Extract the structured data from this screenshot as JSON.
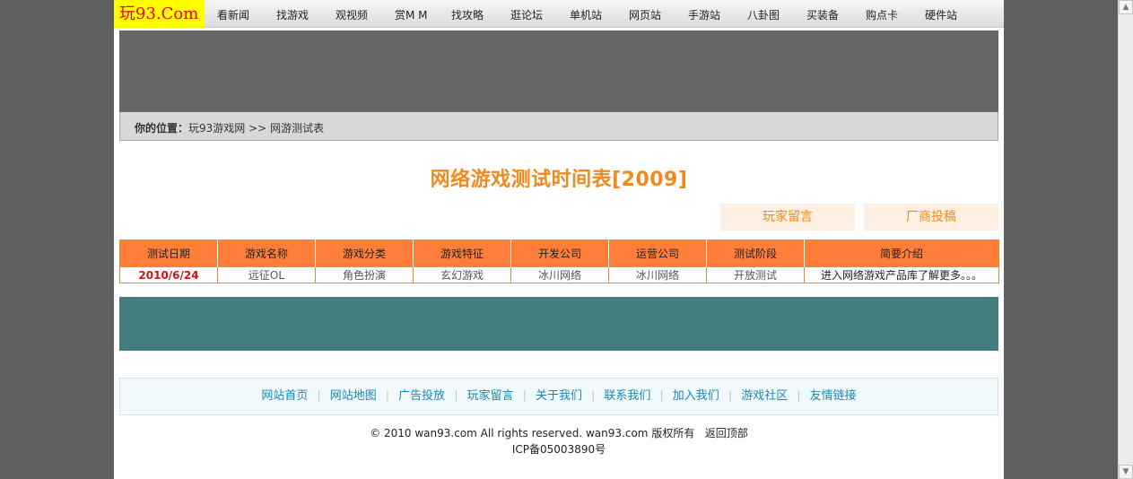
{
  "logo": "玩93.Com",
  "nav": [
    "看新闻",
    "找游戏",
    "观视频",
    "赏M M",
    "找攻略",
    "逛论坛",
    "单机站",
    "网页站",
    "手游站",
    "八卦图",
    "买装备",
    "购点卡",
    "硬件站"
  ],
  "breadcrumb": {
    "label": "你的位置：",
    "home": "玩93游戏网",
    "sep": ">>",
    "current": "网游测试表"
  },
  "page_title": "网络游戏测试时间表[2009]",
  "actions": {
    "player_message": "玩家留言",
    "vendor_submit": "厂商投稿"
  },
  "table": {
    "headers": [
      "测试日期",
      "游戏名称",
      "游戏分类",
      "游戏特征",
      "开发公司",
      "运营公司",
      "测试阶段",
      "简要介绍"
    ],
    "rows": [
      [
        "2010/6/24",
        "远征OL",
        "角色扮演",
        "玄幻游戏",
        "冰川网络",
        "冰川网络",
        "开放测试",
        "进入网络游戏产品库了解更多。。。"
      ]
    ]
  },
  "footer": {
    "links": [
      "网站首页",
      "网站地图",
      "广告投放",
      "玩家留言",
      "关于我们",
      "联系我们",
      "加入我们",
      "游戏社区",
      "友情链接"
    ],
    "copyright_prefix": "© 2010 wan93.com All rights reserved.",
    "copyright_site": "wan93.com",
    "copyright_suffix": "版权所有",
    "back_top": "返回顶部",
    "icp": "ICP备05003890号"
  },
  "colors": {
    "accent": "#f08a1e",
    "table_header": "#ff7f3a",
    "logo_bg": "#ffff00",
    "logo_text": "#e60000",
    "banner": "#666666",
    "ad_box": "#437d7d",
    "link": "#1a86b8"
  },
  "icons": {
    "scroll_up": "▲",
    "scroll_down": "▼"
  }
}
